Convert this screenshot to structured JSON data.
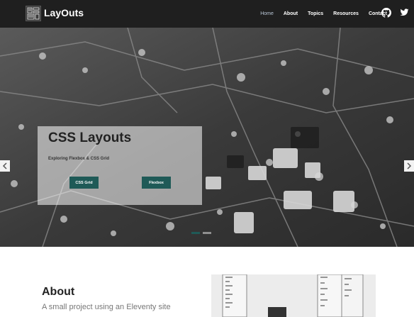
{
  "header": {
    "brand": "LayOuts",
    "nav_items": [
      {
        "label": "Home",
        "active": true
      },
      {
        "label": "About",
        "active": false
      },
      {
        "label": "Topics",
        "active": false
      },
      {
        "label": "Resources",
        "active": false
      },
      {
        "label": "Contact",
        "active": false
      }
    ],
    "social_icons": [
      "github-icon",
      "twitter-icon"
    ]
  },
  "hero": {
    "title": "CSS Layouts",
    "subtitle": "Exploring Flexbox & CSS Grid",
    "buttons": [
      "CSS Grid",
      "Flexbox"
    ],
    "prev_icon": "chevron-left-icon",
    "next_icon": "chevron-right-icon",
    "slides": 2,
    "active_slide": 1
  },
  "about": {
    "heading": "About",
    "text": "A small project using an Eleventy site"
  },
  "colors": {
    "navbar": "#1f1f1f",
    "accent": "#1f5a57",
    "active_nav": "#b9c6d6"
  }
}
